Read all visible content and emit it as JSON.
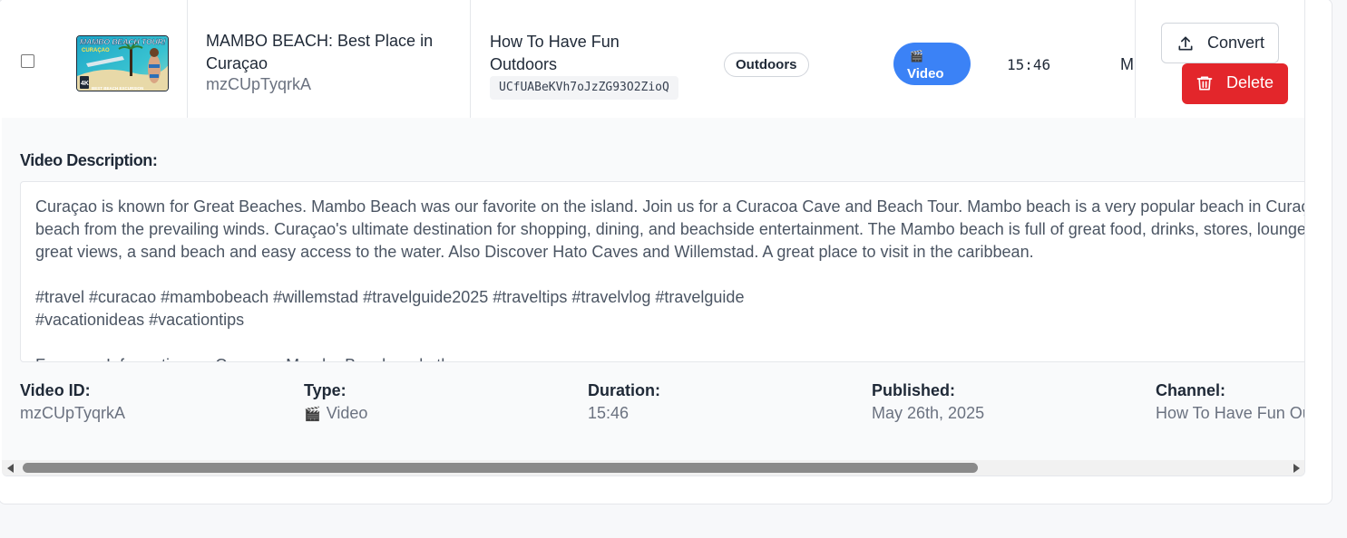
{
  "row": {
    "title": "MAMBO BEACH: Best Place in Curaçao",
    "video_id": "mzCUpTyqrkA",
    "channel_name": "How To Have Fun Outdoors",
    "channel_id": "UCfUABeKVh7oJzZG93O2ZioQ",
    "category": "Outdoors",
    "type_icon": "🎬",
    "type_label": "Video",
    "duration": "15:46",
    "published_truncated": "M",
    "convert_label": "Convert",
    "delete_label": "Delete",
    "thumbnail": {
      "line1": "MAMBO BEACH TOUR!",
      "line2": "CURAÇAO",
      "badge": "4K",
      "footer": "BEST BEACH EXCURSION"
    }
  },
  "details": {
    "description_label": "Video Description:",
    "description_text": "Curaçao is known for Great Beaches. Mambo Beach was our favorite on the island. Join us for a Curacoa Cave and Beach Tour. Mambo beach is a very popular beach in Curaçao that is sheltered\nbeach from the prevailing winds. Curaçao's ultimate destination for shopping, dining, and beachside entertainment. The Mambo beach is full of great food, drinks, stores, lounges, and\ngreat views, a sand beach and easy access to the water. Also Discover Hato Caves and Willemstad. A great place to visit in the caribbean.\n\n#travel #curacao #mambobeach #willemstad #travelguide2025 #traveltips #travelvlog #travelguide\n#vacationideas #vacationtips\n\nFor more Information on Curacao, Mambo Beach and others",
    "meta": [
      {
        "label": "Video ID:",
        "value": "mzCUpTyqrkA"
      },
      {
        "label": "Type:",
        "value": "Video",
        "icon": "🎬"
      },
      {
        "label": "Duration:",
        "value": "15:46"
      },
      {
        "label": "Published:",
        "value": "May 26th, 2025"
      },
      {
        "label": "Channel:",
        "value": "How To Have Fun Outdoors"
      }
    ]
  },
  "colors": {
    "type_badge": "#3b82f6",
    "delete_button": "#e3262b"
  },
  "icons": {
    "convert": "upload-icon",
    "delete": "trash-icon",
    "type": "clapperboard-icon"
  }
}
